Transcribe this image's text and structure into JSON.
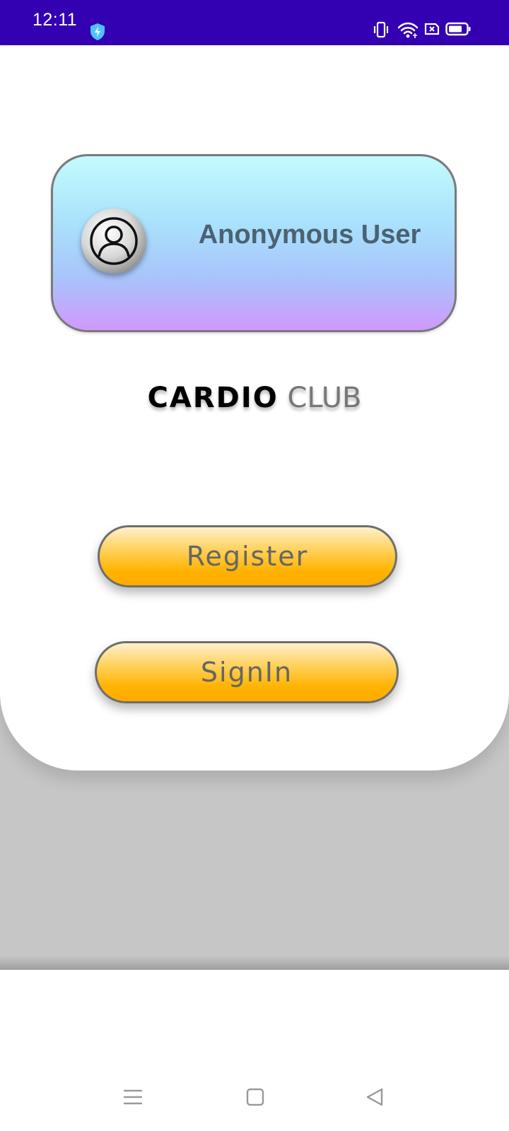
{
  "status_bar": {
    "time": "12:11",
    "icons": [
      "shield-bolt-icon",
      "vibrate-icon",
      "wifi-icon",
      "sim-x-icon",
      "battery-icon"
    ],
    "background_color": "#3300b2"
  },
  "profile": {
    "name": "Anonymous User",
    "avatar_icon": "user-avatar-icon"
  },
  "brand": {
    "bold_text": "CARDIO",
    "light_text": "CLUB"
  },
  "actions": {
    "register_label": "Register",
    "signin_label": "SignIn",
    "button_color": "#ffb300"
  },
  "nav_bar": {
    "buttons": [
      "menu-icon",
      "home-icon",
      "back-icon"
    ]
  }
}
